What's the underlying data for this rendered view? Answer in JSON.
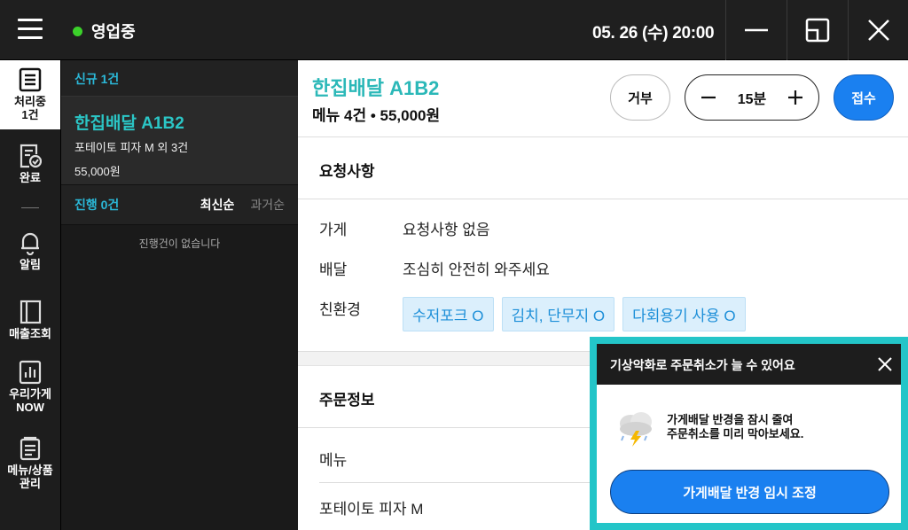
{
  "header": {
    "status": "영업중",
    "status_color": "#3bd12a",
    "datetime": "05. 26 (수) 20:00",
    "icons": [
      "hamburger-menu-icon",
      "minimize-icon",
      "restore-window-icon",
      "close-icon"
    ]
  },
  "rail": {
    "items": [
      {
        "label_line1": "처리중",
        "label_line2": "1건",
        "icon": "document-list-icon"
      },
      {
        "label": "완료",
        "icon": "document-check-icon"
      },
      {
        "label": "알림",
        "icon": "bell-icon"
      },
      {
        "label": "매출조회",
        "icon": "book-icon"
      },
      {
        "label_line1": "우리가게",
        "label_line2": "NOW",
        "icon": "bar-chart-icon"
      },
      {
        "label_line1": "메뉴/상품",
        "label_line2": "관리",
        "icon": "menu-document-icon"
      }
    ]
  },
  "list": {
    "new_header": "신규 1건",
    "order": {
      "name": "한집배달 A1B2",
      "desc": "포테이토 피자 M 외 3건",
      "price": "55,000원"
    },
    "progress_header": "진행 0건",
    "sort_latest": "최신순",
    "sort_past": "과거순",
    "empty_text": "진행건이 없습니다"
  },
  "main": {
    "title": "한집배달 A1B2",
    "subtitle": "메뉴 4건 • 55,000원",
    "reject_label": "거부",
    "time_value": "15분",
    "accept_label": "접수",
    "accent": "#1a80f0",
    "request_title": "요청사항",
    "requests": [
      {
        "key": "가게",
        "value": "요청사항 없음"
      },
      {
        "key": "배달",
        "value": "조심히 안전히 와주세요"
      }
    ],
    "eco_key": "친환경",
    "eco_chips": [
      "수저포크 O",
      "김치, 단무지 O",
      "다회용기 사용 O"
    ],
    "order_info_title": "주문정보",
    "menu_header": "메뉴",
    "menu_item": "포테이토 피자 M"
  },
  "popup": {
    "title": "기상악화로 주문취소가 늘 수 있어요",
    "text_line1": "가게배달 반경을 잠시 줄여",
    "text_line2": "주문취소를 미리 막아보세요.",
    "button": "가게배달 반경 임시 조정",
    "border_color": "#23c5c8"
  }
}
